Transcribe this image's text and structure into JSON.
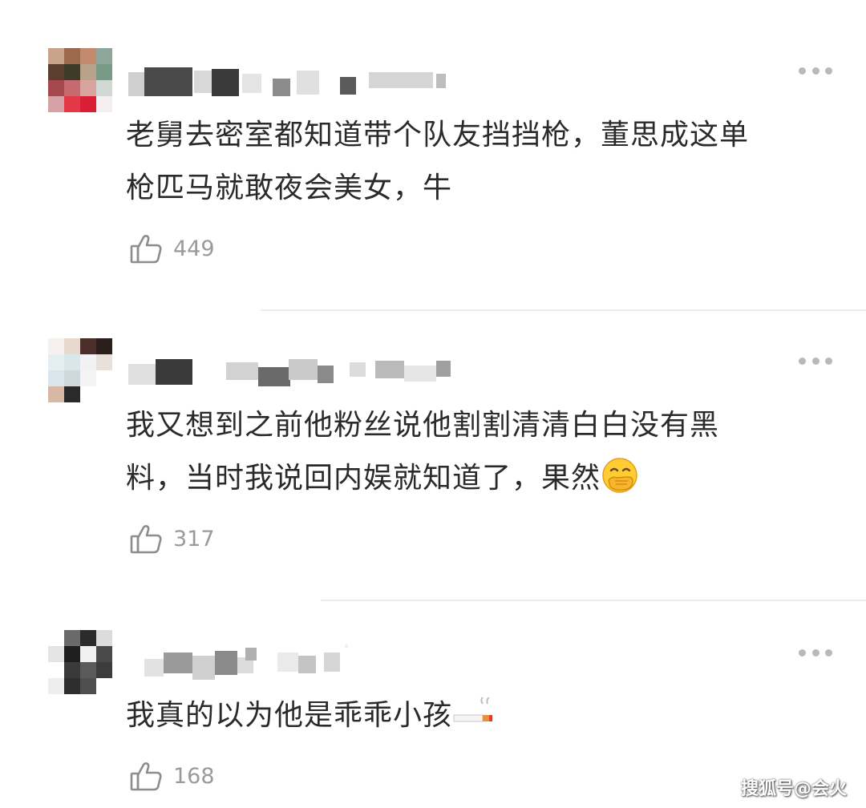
{
  "comments": [
    {
      "text_lines": [
        "老舅去密室都知道带个队友挡挡枪，董思成这单",
        "枪匹马就敢夜会美女，牛"
      ],
      "likes": "449",
      "avatar_colors": [
        "#c8a58a",
        "#9b6a4e",
        "#c48a6e",
        "#8fa79a",
        "#5b3e2e",
        "#3f3a2a",
        "#b8a38a",
        "#7a9a88",
        "#a5494e",
        "#c66a70",
        "#d9a4a0",
        "#cfd8d2",
        "#d4a1a5",
        "#e33845",
        "#d91e35",
        "#f4eeee"
      ],
      "name_mosaic_colors": [
        "#cfcfcf",
        "#4a4a4a",
        "#d8d8d8",
        "#3a3a3a",
        "#e4e4e4",
        "#8c8c8c",
        "#e0e0e0",
        "#5a5a5a",
        "#d5d5d5",
        "#bdbdbd"
      ]
    },
    {
      "text_lines": [
        "我又想到之前他粉丝说他割割清清白白没有黑",
        "料，当时我说回内娱就知道了，果然"
      ],
      "likes": "317",
      "avatar_colors": [
        "#f6f1ef",
        "#e6d8cf",
        "#4b2e2a",
        "#2a1f1d",
        "#e7eef1",
        "#d9e7ea",
        "#f2f2f2",
        "#e8e0da",
        "#dbe6ec",
        "#cfd8dd",
        "#f4f4f4",
        "#ffffff",
        "#d8b8a4",
        "#2a2a2a",
        "#ffffff",
        "#ffffff"
      ],
      "name_mosaic_colors": [
        "#e0e0e0",
        "#3a3a3a",
        "#d2d2d2",
        "#6a6a6a",
        "#cacaca",
        "#8a8a8a",
        "#dcdcdc",
        "#bababa",
        "#e6e6e6",
        "#a0a0a0"
      ]
    },
    {
      "text_lines": [
        "我真的以为他是乖乖小孩"
      ],
      "likes": "168",
      "avatar_colors": [
        "#ffffff",
        "#6a6a6a",
        "#2b2b2b",
        "#dcdcdc",
        "#e4e4e4",
        "#1f1f1f",
        "#f1f1f1",
        "#4a4a4a",
        "#ffffff",
        "#3a3a3a",
        "#5a5a5a",
        "#3c3c3c",
        "#eeeeee",
        "#2e2e2e",
        "#4e4e4e",
        "#ffffff"
      ],
      "name_mosaic_colors": [
        "#e2e2e2",
        "#9a9a9a",
        "#cfcfcf",
        "#8a8a8a",
        "#dcdcdc",
        "#b0b0b0",
        "#eaeaea",
        "#c4c4c4",
        "#d6d6d6",
        "#f0f0f0"
      ]
    }
  ],
  "watermark": "搜狐号@会火",
  "icons": {
    "like": "thumbs-up-icon",
    "more": "more-dots-icon",
    "emoji_1": "hand-over-mouth-emoji",
    "emoji_2": "cigarette-emoji"
  }
}
